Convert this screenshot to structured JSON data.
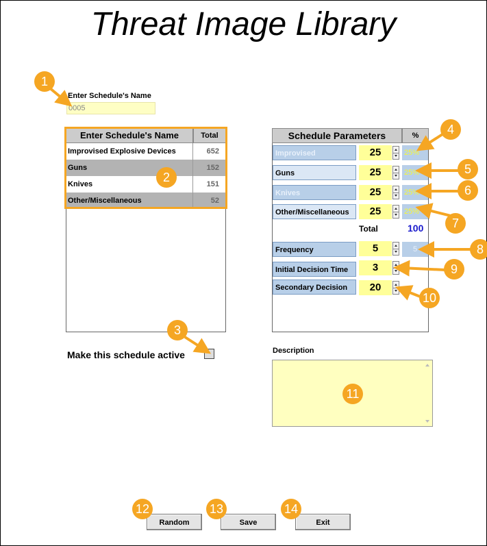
{
  "title": "Threat Image Library",
  "schedule_name": {
    "label": "Enter Schedule's Name",
    "value": "0005"
  },
  "list": {
    "header_name": "Enter Schedule's Name",
    "header_total": "Total",
    "rows": [
      {
        "name": "Improvised Explosive Devices",
        "total": "652"
      },
      {
        "name": "Guns",
        "total": "152"
      },
      {
        "name": "Knives",
        "total": "151"
      },
      {
        "name": "Other/Miscellaneous",
        "total": "52"
      }
    ]
  },
  "params": {
    "header_name": "Schedule Parameters",
    "header_pct": "%",
    "categories": [
      {
        "label": "Improvised",
        "value": "25",
        "pct": "25%"
      },
      {
        "label": "Guns",
        "value": "25",
        "pct": "25%"
      },
      {
        "label": "Knives",
        "value": "25",
        "pct": "25%"
      },
      {
        "label": "Other/Miscellaneous",
        "value": "25",
        "pct": "25%"
      }
    ],
    "total_label": "Total",
    "total_value": "100",
    "frequency": {
      "label": "Frequency",
      "value": "5",
      "display": "5"
    },
    "initial_decision": {
      "label": "Initial Decision Time",
      "value": "3"
    },
    "secondary_decision": {
      "label": "Secondary Decision",
      "value": "20"
    }
  },
  "active": {
    "label": "Make this schedule active",
    "checked": false
  },
  "description": {
    "label": "Description",
    "value": ""
  },
  "buttons": {
    "random": "Random",
    "save": "Save",
    "exit": "Exit"
  },
  "callouts": [
    "1",
    "2",
    "3",
    "4",
    "5",
    "6",
    "7",
    "8",
    "9",
    "10",
    "11",
    "12",
    "13",
    "14"
  ],
  "colors": {
    "callout": "#f5a623",
    "input_bg": "#ffff99",
    "param_label_bg": "#b8cfe8",
    "total_color": "#1a1acc"
  }
}
